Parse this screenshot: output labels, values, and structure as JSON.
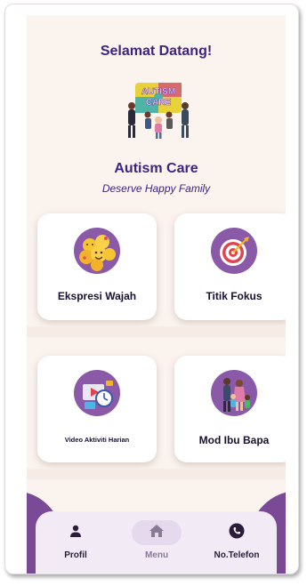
{
  "header": {
    "welcome": "Selamat Datang!",
    "logo_text_line1": "AUTISM",
    "logo_text_line2": "CARE",
    "app_title": "Autism Care",
    "tagline": "Deserve Happy Family"
  },
  "cards": [
    {
      "label": "Ekspresi Wajah",
      "icon": "emoji-faces-icon"
    },
    {
      "label": "Titik Fokus",
      "icon": "target-icon"
    },
    {
      "label": "Video Aktiviti Harian",
      "icon": "video-calendar-icon"
    },
    {
      "label": "Mod Ibu Bapa",
      "icon": "family-icon"
    }
  ],
  "nav": {
    "items": [
      {
        "label": "Profil",
        "icon": "person-icon",
        "active": false
      },
      {
        "label": "Menu",
        "icon": "home-icon",
        "active": true
      },
      {
        "label": "No.Telefon",
        "icon": "phone-icon",
        "active": false
      }
    ]
  },
  "colors": {
    "accent": "#3e2380",
    "icon_bg": "#8a5aa8",
    "nav_bg": "#f2eaf5",
    "screen_bg": "#fbf3ee"
  }
}
